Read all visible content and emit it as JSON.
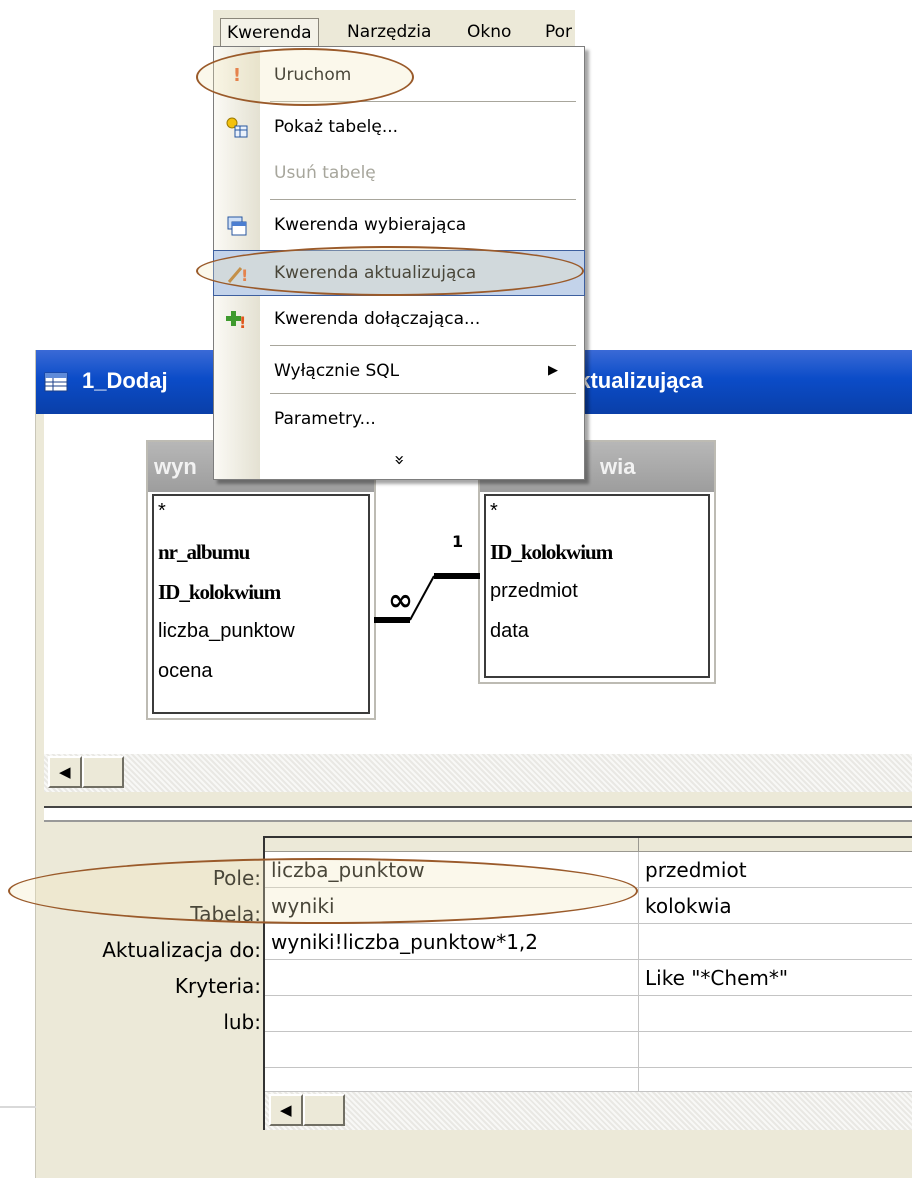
{
  "menubar": {
    "items": [
      "Kwerenda",
      "Narzędzia",
      "Okno",
      "Por"
    ]
  },
  "menu": {
    "items": [
      {
        "label": "Uruchom",
        "icon": "exclamation-icon"
      },
      {
        "label": "Pokaż tabelę...",
        "icon": "show-table-icon"
      },
      {
        "label": "Usuń tabelę",
        "icon": "",
        "disabled": true
      },
      {
        "label": "Kwerenda wybierająca",
        "icon": "select-query-icon"
      },
      {
        "label": "Kwerenda aktualizująca",
        "icon": "update-query-icon",
        "highlighted": true
      },
      {
        "label": "Kwerenda dołączająca...",
        "icon": "append-query-icon"
      },
      {
        "label": "Wyłącznie SQL",
        "icon": "",
        "submenu": true
      },
      {
        "label": "Parametry...",
        "icon": ""
      }
    ],
    "expand_glyph": "»"
  },
  "window": {
    "title_left": "1_Dodaj",
    "title_right": "aktualizująca",
    "titlebar_color": "#0b4cc8"
  },
  "tables": [
    {
      "header": "wyn",
      "fields": [
        "*",
        "nr_albumu",
        "ID_kolokwium",
        "liczba_punktow",
        "ocena"
      ]
    },
    {
      "header": "wia",
      "fields": [
        "*",
        "ID_kolokwium",
        "przedmiot",
        "data"
      ]
    }
  ],
  "relationship": {
    "many": "∞",
    "one": "1"
  },
  "grid": {
    "row_labels": [
      "Pole:",
      "Tabela:",
      "Aktualizacja do:",
      "Kryteria:",
      "lub:"
    ],
    "columns": [
      {
        "values": [
          "liczba_punktow",
          "wyniki",
          "wyniki!liczba_punktow*1,2",
          "",
          ""
        ]
      },
      {
        "values": [
          "przedmiot",
          "kolokwia",
          "",
          "Like \"*Chem*\"",
          ""
        ]
      }
    ]
  },
  "annotation_color": "#9a5a2a"
}
